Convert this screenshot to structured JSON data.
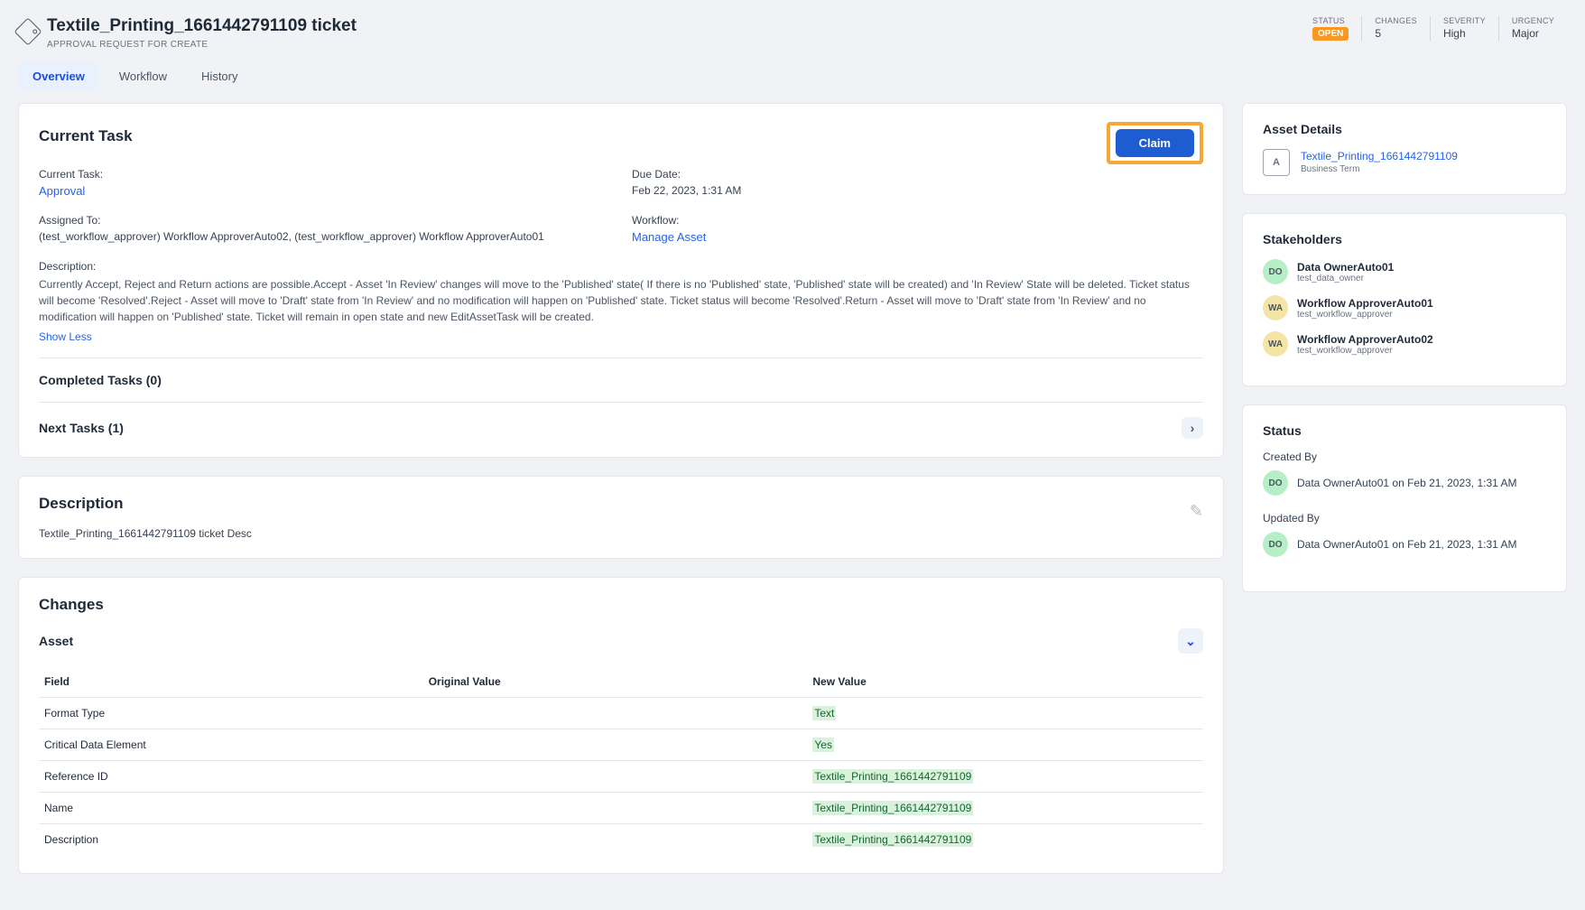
{
  "header": {
    "title": "Textile_Printing_1661442791109 ticket",
    "subtitle": "APPROVAL REQUEST FOR CREATE",
    "metrics": {
      "status_label": "STATUS",
      "status_value": "OPEN",
      "changes_label": "CHANGES",
      "changes_value": "5",
      "severity_label": "SEVERITY",
      "severity_value": "High",
      "urgency_label": "URGENCY",
      "urgency_value": "Major"
    }
  },
  "tabs": {
    "overview": "Overview",
    "workflow": "Workflow",
    "history": "History"
  },
  "current_task": {
    "heading": "Current Task",
    "claim_label": "Claim",
    "current_task_label": "Current Task:",
    "current_task_value": "Approval",
    "due_date_label": "Due Date:",
    "due_date_value": "Feb 22, 2023, 1:31 AM",
    "assigned_to_label": "Assigned To:",
    "assigned_to_value": "(test_workflow_approver) Workflow ApproverAuto02, (test_workflow_approver) Workflow ApproverAuto01",
    "workflow_label": "Workflow:",
    "workflow_value": "Manage Asset",
    "description_label": "Description:",
    "description_value": "Currently Accept, Reject and Return actions are possible.Accept - Asset 'In Review' changes will move to the 'Published' state( If there is no 'Published' state, 'Published' state will be created) and 'In Review' State will be deleted. Ticket status will become 'Resolved'.Reject - Asset will move to 'Draft' state from 'In Review' and no modification will happen on 'Published' state. Ticket status will become 'Resolved'.Return - Asset will move to 'Draft' state from 'In Review' and no modification will happen on 'Published' state. Ticket will remain in open state and new EditAssetTask will be created.",
    "show_less": "Show Less",
    "completed_tasks": "Completed Tasks (0)",
    "next_tasks": "Next Tasks (1)"
  },
  "description_card": {
    "heading": "Description",
    "body": "Textile_Printing_1661442791109 ticket Desc"
  },
  "changes_card": {
    "heading": "Changes",
    "asset_label": "Asset",
    "columns": {
      "field": "Field",
      "original": "Original Value",
      "new": "New Value"
    },
    "rows": [
      {
        "field": "Format Type",
        "original": "",
        "new": "Text"
      },
      {
        "field": "Critical Data Element",
        "original": "",
        "new": "Yes"
      },
      {
        "field": "Reference ID",
        "original": "",
        "new": "Textile_Printing_1661442791109"
      },
      {
        "field": "Name",
        "original": "",
        "new": "Textile_Printing_1661442791109"
      },
      {
        "field": "Description",
        "original": "",
        "new": "Textile_Printing_1661442791109"
      }
    ]
  },
  "asset_details": {
    "heading": "Asset Details",
    "icon_text": "A",
    "title": "Textile_Printing_1661442791109",
    "subtitle": "Business Term"
  },
  "stakeholders": {
    "heading": "Stakeholders",
    "items": [
      {
        "initials": "DO",
        "name": "Data OwnerAuto01",
        "role": "test_data_owner",
        "cls": "av-green"
      },
      {
        "initials": "WA",
        "name": "Workflow ApproverAuto01",
        "role": "test_workflow_approver",
        "cls": "av-yellow"
      },
      {
        "initials": "WA",
        "name": "Workflow ApproverAuto02",
        "role": "test_workflow_approver",
        "cls": "av-yellow"
      }
    ]
  },
  "status": {
    "heading": "Status",
    "created_by_label": "Created By",
    "created_by_initials": "DO",
    "created_by_text": "Data OwnerAuto01 on Feb 21, 2023, 1:31 AM",
    "updated_by_label": "Updated By",
    "updated_by_initials": "DO",
    "updated_by_text": "Data OwnerAuto01 on Feb 21, 2023, 1:31 AM"
  }
}
